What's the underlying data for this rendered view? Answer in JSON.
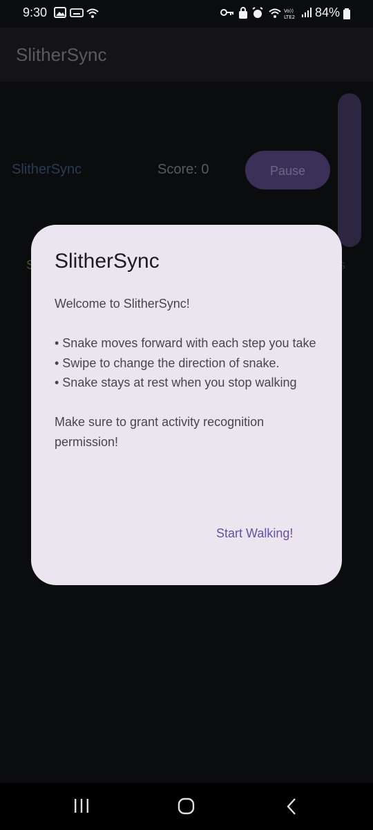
{
  "status_bar": {
    "time": "9:30",
    "battery": "84%",
    "icons": [
      "gallery-icon",
      "keyboard-icon",
      "wifi-icon",
      "key-icon",
      "lock-icon",
      "alarm-icon",
      "wifi-calling-icon",
      "volte-icon",
      "signal-icon",
      "battery-icon"
    ]
  },
  "app_bar": {
    "title": "SlitherSync"
  },
  "game": {
    "name": "SlitherSync",
    "score": "Score: 0",
    "pause_label": "Pause",
    "partial_left": "S",
    "partial_right": "s"
  },
  "dialog": {
    "title": "SlitherSync",
    "welcome": "Welcome to SlitherSync!",
    "bullets": [
      "• Snake moves forward with each step you take",
      "• Swipe to change the direction of snake.",
      "• Snake stays at rest when you stop walking"
    ],
    "note": "Make sure to grant activity recognition permission!",
    "action_label": "Start Walking!"
  },
  "nav_bar": {
    "buttons": [
      "recents-icon",
      "home-icon",
      "back-icon"
    ]
  },
  "colors": {
    "dialog_bg": "#ebe5f0",
    "accent": "#6750a4",
    "background": "#0b0c0e"
  }
}
